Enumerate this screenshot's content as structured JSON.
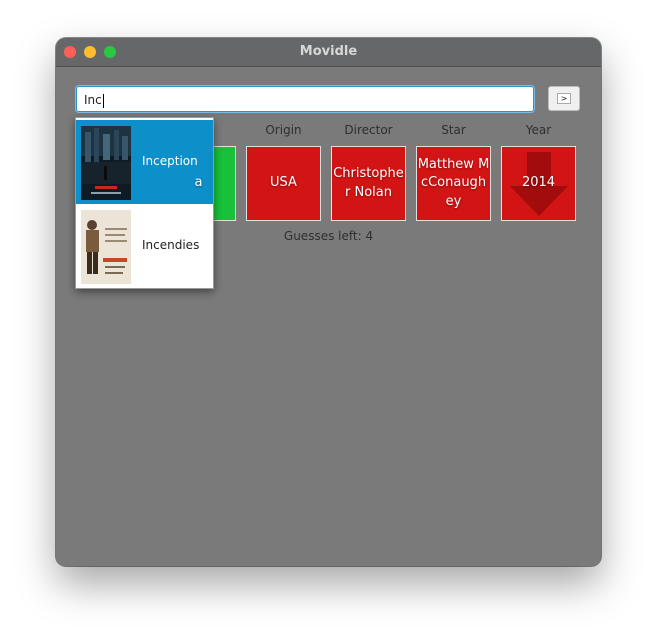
{
  "window": {
    "title": "Movidle"
  },
  "search": {
    "value": "Inc",
    "submit_label": ">"
  },
  "columns": [
    "Origin",
    "Director",
    "Star",
    "Year"
  ],
  "tiles": [
    {
      "value": "a",
      "status": "correct"
    },
    {
      "value": "USA",
      "status": "wrong"
    },
    {
      "value": "Christopher Nolan",
      "status": "wrong"
    },
    {
      "value": "Matthew McConaughey",
      "status": "wrong"
    },
    {
      "value": "2014",
      "status": "wrong",
      "hint_icon": "arrow-down-icon"
    }
  ],
  "guesses_left": "Guesses left: 4",
  "suggestions": [
    {
      "title": "Inception",
      "selected": true
    },
    {
      "title": "Incendies",
      "selected": false
    }
  ],
  "colors": {
    "correct": "#17c23a",
    "wrong": "#d21414",
    "selection": "#0d8fc9"
  }
}
